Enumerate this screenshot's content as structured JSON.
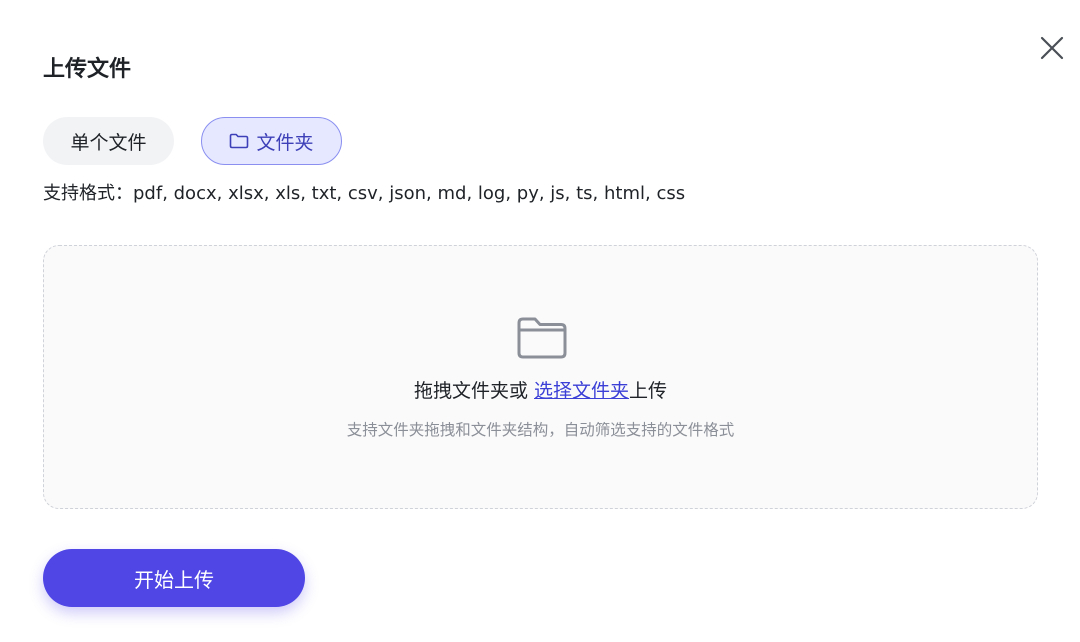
{
  "dialog": {
    "title": "上传文件",
    "close_icon": "close-icon"
  },
  "tabs": [
    {
      "label": "单个文件",
      "icon": null,
      "active": false
    },
    {
      "label": "文件夹",
      "icon": "folder-icon",
      "active": true
    }
  ],
  "formats": {
    "label": "支持格式：",
    "list": "pdf, docx, xlsx, xls, txt, csv, json, md, log, py, js, ts, html, css"
  },
  "dropzone": {
    "icon": "folder-icon",
    "main_prefix": "拖拽文件夹或 ",
    "link_text": "选择文件夹",
    "main_suffix": "上传",
    "hint": "支持文件夹拖拽和文件夹结构，自动筛选支持的文件格式"
  },
  "actions": {
    "start_label": "开始上传"
  },
  "colors": {
    "accent": "#4f46e5",
    "active_tab_bg": "#e6e8ff",
    "active_tab_border": "#8a8ff0",
    "link": "#3b3fd6",
    "hint_text": "#8b8f97"
  }
}
